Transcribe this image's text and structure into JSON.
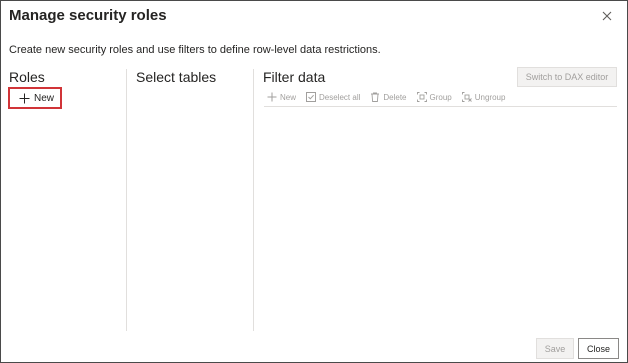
{
  "dialog": {
    "title": "Manage security roles",
    "subtitle": "Create new security roles and use filters to define row-level data restrictions."
  },
  "roles": {
    "heading": "Roles",
    "new_label": "New"
  },
  "tables": {
    "heading": "Select tables"
  },
  "filter": {
    "heading": "Filter data",
    "switch_label": "Switch to DAX editor",
    "toolbar": {
      "new": "New",
      "deselect_all": "Deselect all",
      "delete": "Delete",
      "group": "Group",
      "ungroup": "Ungroup"
    }
  },
  "footer": {
    "save": "Save",
    "close": "Close"
  },
  "colors": {
    "highlight": "#d13438",
    "disabled_text": "#a19f9d",
    "divider": "#e1dfdd"
  }
}
